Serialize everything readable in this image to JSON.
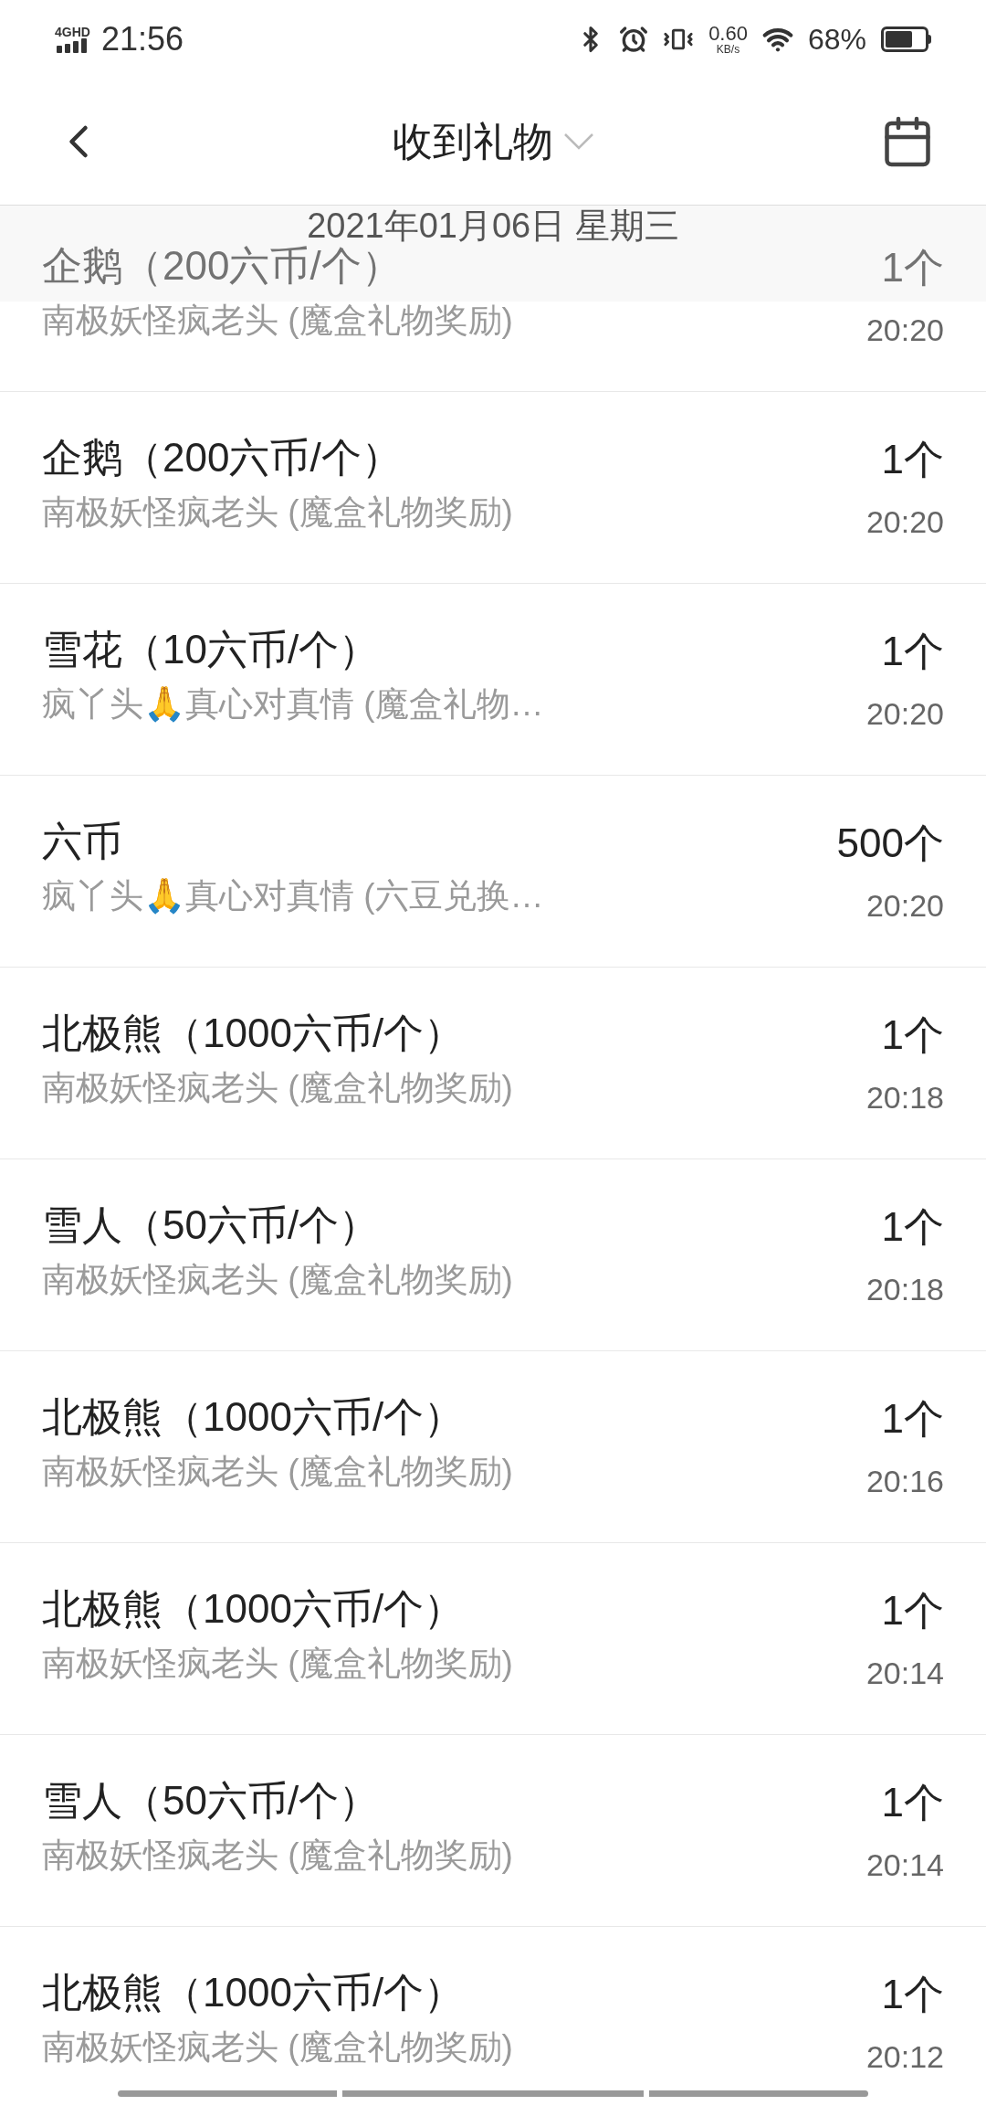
{
  "status_bar": {
    "network": "4GHD",
    "time": "21:56",
    "speed": "0.60",
    "speed_unit": "KB/s",
    "battery": "68%"
  },
  "header": {
    "title": "收到礼物"
  },
  "date_header": "2021年01月06日 星期三",
  "gifts": [
    {
      "name": "企鹅（200六币/个）",
      "sender": "南极妖怪疯老头 (魔盒礼物奖励)",
      "quantity": "1个",
      "time": "20:20"
    },
    {
      "name": "企鹅（200六币/个）",
      "sender": "南极妖怪疯老头 (魔盒礼物奖励)",
      "quantity": "1个",
      "time": "20:20"
    },
    {
      "name": "雪花（10六币/个）",
      "sender": "疯丫头🙏真心对真情 (魔盒礼物…",
      "quantity": "1个",
      "time": "20:20"
    },
    {
      "name": "六币",
      "sender": "疯丫头🙏真心对真情 (六豆兑换…",
      "quantity": "500个",
      "time": "20:20"
    },
    {
      "name": "北极熊（1000六币/个）",
      "sender": "南极妖怪疯老头 (魔盒礼物奖励)",
      "quantity": "1个",
      "time": "20:18"
    },
    {
      "name": "雪人（50六币/个）",
      "sender": "南极妖怪疯老头 (魔盒礼物奖励)",
      "quantity": "1个",
      "time": "20:18"
    },
    {
      "name": "北极熊（1000六币/个）",
      "sender": "南极妖怪疯老头 (魔盒礼物奖励)",
      "quantity": "1个",
      "time": "20:16"
    },
    {
      "name": "北极熊（1000六币/个）",
      "sender": "南极妖怪疯老头 (魔盒礼物奖励)",
      "quantity": "1个",
      "time": "20:14"
    },
    {
      "name": "雪人（50六币/个）",
      "sender": "南极妖怪疯老头 (魔盒礼物奖励)",
      "quantity": "1个",
      "time": "20:14"
    },
    {
      "name": "北极熊（1000六币/个）",
      "sender": "南极妖怪疯老头 (魔盒礼物奖励)",
      "quantity": "1个",
      "time": "20:12"
    }
  ]
}
